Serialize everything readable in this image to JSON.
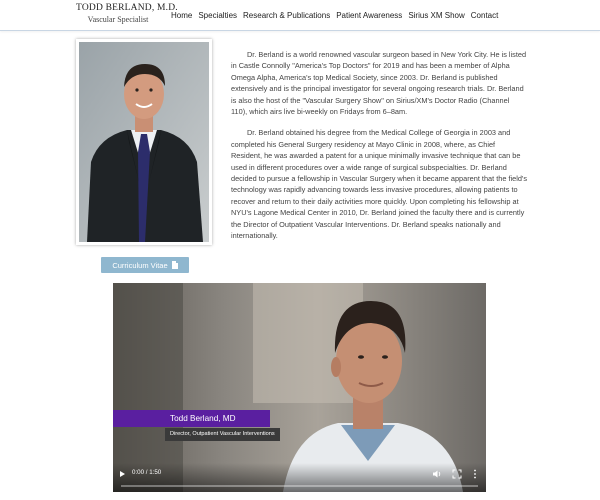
{
  "header": {
    "logo_name": "TODD BERLAND, M.D.",
    "logo_subtitle": "Vascular Specialist",
    "nav": [
      {
        "label": "Home"
      },
      {
        "label": "Specialties"
      },
      {
        "label": "Research & Publications"
      },
      {
        "label": "Patient Awareness"
      },
      {
        "label": "Sirius XM Show"
      },
      {
        "label": "Contact"
      }
    ]
  },
  "profile": {
    "cv_label": "Curriculum Vitae",
    "cv_icon": "document-icon"
  },
  "bio": {
    "paragraphs": [
      "Dr. Berland is a world renowned vascular surgeon based in New York City. He is listed in Castle Connolly \"America's Top Doctors\" for 2019 and has been a member of Alpha Omega Alpha, America's top Medical Society, since 2003. Dr. Berland is published extensively and is the principal investigator for several ongoing research trials. Dr. Berland is also the host of the \"Vascular Surgery Show\" on Sirius/XM's Doctor Radio (Channel 110), which airs live bi-weekly on Fridays from 6–8am.",
      "Dr. Berland obtained his degree from the Medical College of Georgia in 2003 and completed his General Surgery residency at Mayo Clinic in 2008, where, as Chief Resident, he was awarded a patent for a unique minimally invasive technique that can be used in different procedures over a wide range of surgical subspecialties. Dr. Berland decided to pursue a fellowship in Vascular Surgery when it became apparent that the field's technology was rapidly advancing towards less invasive procedures, allowing patients to recover and return to their daily activities more quickly. Upon completing his fellowship at NYU's Lagone Medical Center in 2010, Dr. Berland joined the faculty there and is currently the Director of Outpatient Vascular Interventions. Dr. Berland speaks nationally and internationally."
    ]
  },
  "video": {
    "lower_third_name": "Todd Berland, MD",
    "lower_third_title": "Director, Outpatient Vascular Interventions",
    "time": "0:00 / 1:50",
    "progress": 0,
    "accent_color": "#5a1fa0"
  }
}
